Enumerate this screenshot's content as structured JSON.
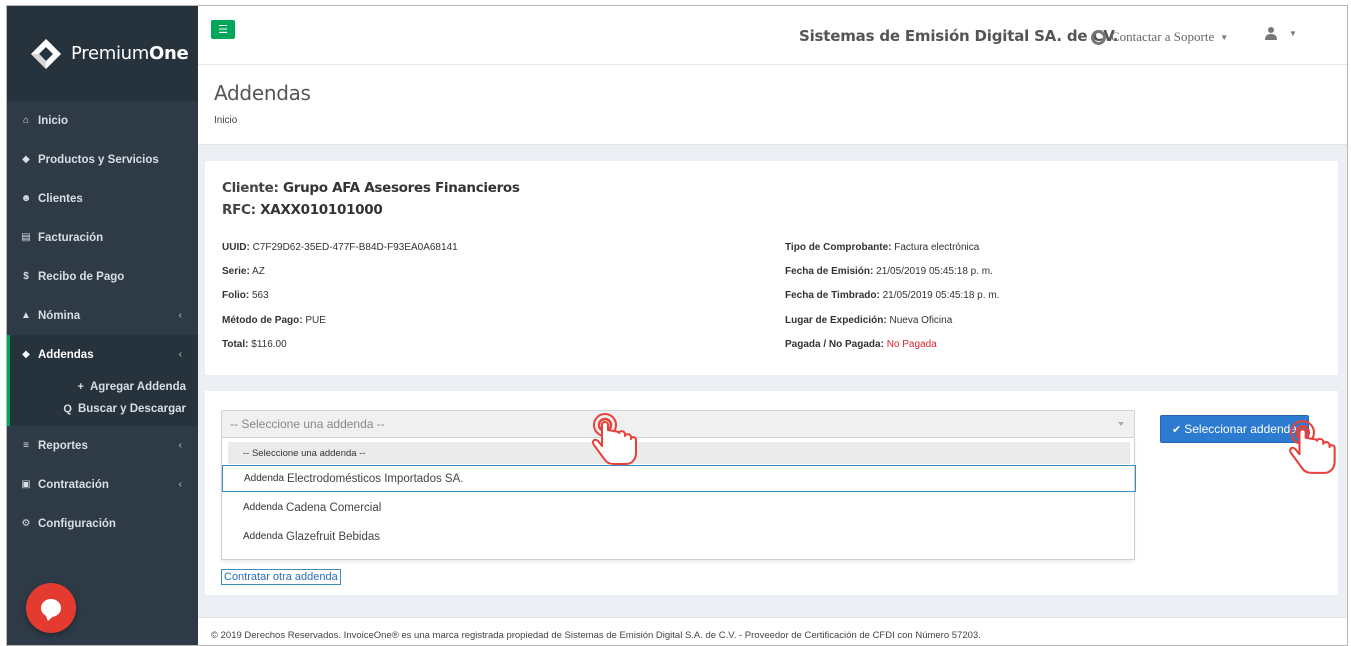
{
  "app": {
    "logo_prefix": "Premium",
    "logo_bold": "One"
  },
  "sidebar": {
    "items": [
      {
        "label": "Inicio",
        "icon": "home-icon"
      },
      {
        "label": "Productos y Servicios",
        "icon": "tag-icon"
      },
      {
        "label": "Clientes",
        "icon": "users-icon"
      },
      {
        "label": "Facturación",
        "icon": "document-icon"
      },
      {
        "label": "Recibo de Pago",
        "icon": "dollar-icon"
      },
      {
        "label": "Nómina",
        "icon": "sitemap-icon"
      },
      {
        "label": "Addendas",
        "icon": "tag-icon"
      },
      {
        "label": "Reportes",
        "icon": "list-icon"
      },
      {
        "label": "Contratación",
        "icon": "cart-icon"
      },
      {
        "label": "Configuración",
        "icon": "cogs-icon"
      }
    ],
    "submenu": [
      {
        "label": "Agregar Addenda",
        "icon": "plus-icon"
      },
      {
        "label": "Buscar y Descargar",
        "icon": "search-icon"
      }
    ]
  },
  "header": {
    "company": "Sistemas de Emisión Digital SA. de CV.",
    "support": "Contactar a Soporte"
  },
  "page": {
    "title": "Addendas",
    "breadcrumb": "Inicio"
  },
  "invoice": {
    "client_label": "Cliente:",
    "client_value": "Grupo AFA Asesores Financieros",
    "rfc_label": "RFC:",
    "rfc_value": "XAXX010101000",
    "left": [
      {
        "label": "UUID:",
        "value": "C7F29D62-35ED-477F-B84D-F93EA0A68141"
      },
      {
        "label": "Serie:",
        "value": "AZ"
      },
      {
        "label": "Folio:",
        "value": "563"
      },
      {
        "label": "Método de Pago:",
        "value": "PUE"
      },
      {
        "label": "Total:",
        "value": "$116.00"
      }
    ],
    "right": [
      {
        "label": "Tipo de Comprobante:",
        "value": "Factura electrónica"
      },
      {
        "label": "Fecha de Emisión:",
        "value": "21/05/2019 05:45:18 p. m."
      },
      {
        "label": "Fecha de Timbrado:",
        "value": "21/05/2019 05:45:18 p. m."
      },
      {
        "label": "Lugar de Expedición:",
        "value": "Nueva Oficina"
      },
      {
        "label": "Pagada / No Pagada:",
        "value": "No Pagada"
      }
    ]
  },
  "addenda": {
    "select_placeholder": "-- Seleccione una addenda --",
    "options": [
      {
        "prefix": "",
        "name": "-- Seleccione una addenda --"
      },
      {
        "prefix": "Addenda",
        "name": "Electrodomésticos Importados SA."
      },
      {
        "prefix": "Addenda",
        "name": "Cadena Comercial"
      },
      {
        "prefix": "Addenda",
        "name": "Glazefruit Bebidas"
      }
    ],
    "button": "Seleccionar addenda",
    "contract_link": "Contratar otra addenda"
  },
  "footer": {
    "text": "© 2019 Derechos Reservados. InvoiceOne® es una marca registrada propiedad de Sistemas de Emisión Digital S.A. de C.V. - Proveedor de Certificación de CFDI con Número 57203."
  },
  "colors": {
    "sidebar": "#2e3b47",
    "accent_green": "#00a65a",
    "primary_blue": "#2c7bd1",
    "unpaid_red": "#d9232d",
    "tap_indicator": "#e8413a"
  }
}
